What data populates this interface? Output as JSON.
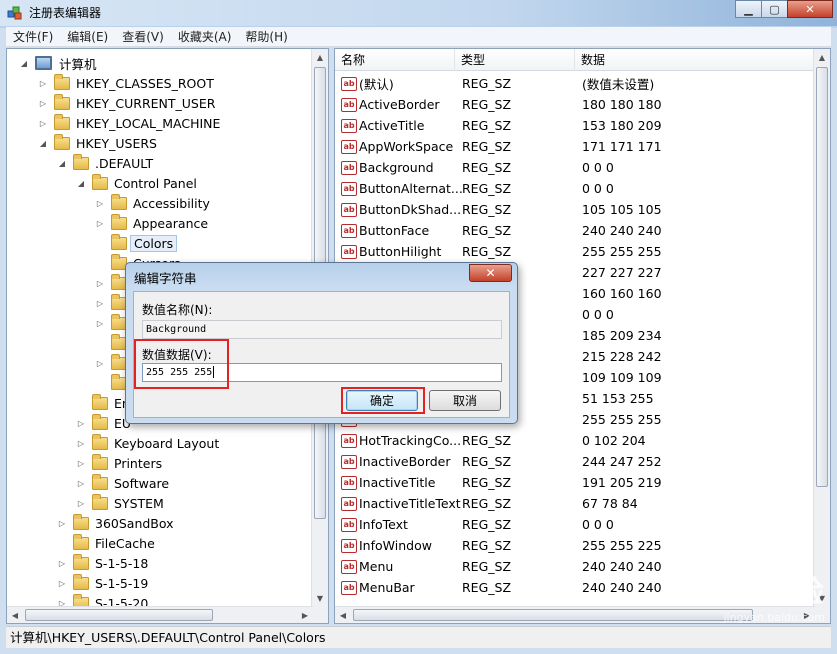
{
  "window": {
    "title": "注册表编辑器",
    "min_glyph": "▁",
    "max_glyph": "▢",
    "close_glyph": "✕"
  },
  "menu": [
    "文件(F)",
    "编辑(E)",
    "查看(V)",
    "收藏夹(A)",
    "帮助(H)"
  ],
  "tree": [
    {
      "label": "计算机",
      "depth": 0,
      "expander": "◢",
      "icon": "computer-icon"
    },
    {
      "label": "HKEY_CLASSES_ROOT",
      "depth": 1,
      "expander": "▷"
    },
    {
      "label": "HKEY_CURRENT_USER",
      "depth": 1,
      "expander": "▷"
    },
    {
      "label": "HKEY_LOCAL_MACHINE",
      "depth": 1,
      "expander": "▷"
    },
    {
      "label": "HKEY_USERS",
      "depth": 1,
      "expander": "◢"
    },
    {
      "label": ".DEFAULT",
      "depth": 2,
      "expander": "◢"
    },
    {
      "label": "Control Panel",
      "depth": 3,
      "expander": "◢"
    },
    {
      "label": "Accessibility",
      "depth": 4,
      "expander": "▷"
    },
    {
      "label": "Appearance",
      "depth": 4,
      "expander": "▷"
    },
    {
      "label": "Colors",
      "depth": 4,
      "expander": "",
      "selected": true
    },
    {
      "label": "Cursors",
      "depth": 4,
      "expander": ""
    },
    {
      "label": "",
      "depth": 4,
      "expander": "▷"
    },
    {
      "label": "",
      "depth": 4,
      "expander": "▷"
    },
    {
      "label": "",
      "depth": 4,
      "expander": "▷"
    },
    {
      "label": "",
      "depth": 4,
      "expander": ""
    },
    {
      "label": "",
      "depth": 4,
      "expander": "▷"
    },
    {
      "label": "",
      "depth": 4,
      "expander": ""
    },
    {
      "label": "En",
      "depth": 3,
      "expander": ""
    },
    {
      "label": "EU",
      "depth": 3,
      "expander": "▷"
    },
    {
      "label": "Keyboard Layout",
      "depth": 3,
      "expander": "▷"
    },
    {
      "label": "Printers",
      "depth": 3,
      "expander": "▷"
    },
    {
      "label": "Software",
      "depth": 3,
      "expander": "▷"
    },
    {
      "label": "SYSTEM",
      "depth": 3,
      "expander": "▷"
    },
    {
      "label": "360SandBox",
      "depth": 2,
      "expander": "▷"
    },
    {
      "label": "FileCache",
      "depth": 2,
      "expander": ""
    },
    {
      "label": "S-1-5-18",
      "depth": 2,
      "expander": "▷"
    },
    {
      "label": "S-1-5-19",
      "depth": 2,
      "expander": "▷"
    },
    {
      "label": "S-1-5-20",
      "depth": 2,
      "expander": "▷"
    }
  ],
  "columns": {
    "name": "名称",
    "type": "类型",
    "data": "数据"
  },
  "values": [
    {
      "name": "(默认)",
      "type": "REG_SZ",
      "data": "(数值未设置)"
    },
    {
      "name": "ActiveBorder",
      "type": "REG_SZ",
      "data": "180 180 180"
    },
    {
      "name": "ActiveTitle",
      "type": "REG_SZ",
      "data": "153 180 209"
    },
    {
      "name": "AppWorkSpace",
      "type": "REG_SZ",
      "data": "171 171 171"
    },
    {
      "name": "Background",
      "type": "REG_SZ",
      "data": "0 0 0"
    },
    {
      "name": "ButtonAlternat...",
      "type": "REG_SZ",
      "data": "0 0 0"
    },
    {
      "name": "ButtonDkShad...",
      "type": "REG_SZ",
      "data": "105 105 105"
    },
    {
      "name": "ButtonFace",
      "type": "REG_SZ",
      "data": "240 240 240"
    },
    {
      "name": "ButtonHilight",
      "type": "REG_SZ",
      "data": "255 255 255"
    },
    {
      "name": "",
      "type": "",
      "data": "227 227 227"
    },
    {
      "name": "",
      "type": "",
      "data": "160 160 160"
    },
    {
      "name": "",
      "type": "",
      "data": "0 0 0"
    },
    {
      "name": "",
      "type": "",
      "data": "185 209 234"
    },
    {
      "name": "",
      "type": "",
      "data": "215 228 242"
    },
    {
      "name": "",
      "type": "",
      "data": "109 109 109"
    },
    {
      "name": "",
      "type": "",
      "data": "51 153 255"
    },
    {
      "name": "",
      "type": "",
      "data": "255 255 255"
    },
    {
      "name": "HotTrackingCo...",
      "type": "REG_SZ",
      "data": "0 102 204"
    },
    {
      "name": "InactiveBorder",
      "type": "REG_SZ",
      "data": "244 247 252"
    },
    {
      "name": "InactiveTitle",
      "type": "REG_SZ",
      "data": "191 205 219"
    },
    {
      "name": "InactiveTitleText",
      "type": "REG_SZ",
      "data": "67 78 84"
    },
    {
      "name": "InfoText",
      "type": "REG_SZ",
      "data": "0 0 0"
    },
    {
      "name": "InfoWindow",
      "type": "REG_SZ",
      "data": "255 255 225"
    },
    {
      "name": "Menu",
      "type": "REG_SZ",
      "data": "240 240 240"
    },
    {
      "name": "MenuBar",
      "type": "REG_SZ",
      "data": "240 240 240"
    }
  ],
  "status": "计算机\\HKEY_USERS\\.DEFAULT\\Control Panel\\Colors",
  "dialog": {
    "title": "编辑字符串",
    "close_glyph": "✕",
    "name_label": "数值名称(N):",
    "name_value": "Background",
    "data_label": "数值数据(V):",
    "data_value": "255 255 255",
    "ok": "确定",
    "cancel": "取消"
  },
  "watermark": {
    "brand": "Baidu经验",
    "url": "jingyan.baidu.com"
  },
  "colors": {
    "highlight_box": "#e52222",
    "selection": "#e5eef9"
  }
}
